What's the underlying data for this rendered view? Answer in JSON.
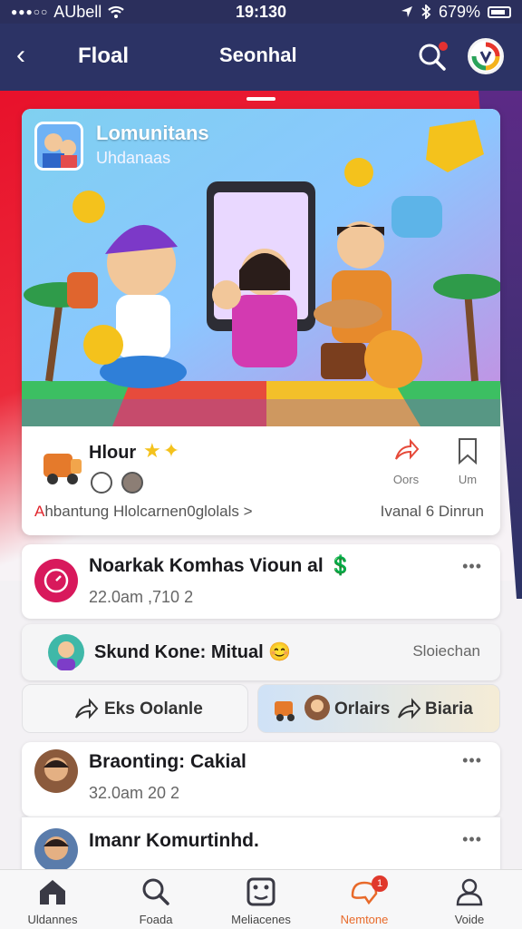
{
  "status_bar": {
    "carrier": "AUbell",
    "time": "19:130",
    "battery": "679%",
    "dots": "●●●○○"
  },
  "header": {
    "back_glyph": "‹",
    "title": "Floal",
    "center_title": "Seonhal"
  },
  "hero": {
    "title": "Lomunitans",
    "subtitle": "Uhdanaas",
    "host_name": "Hlour",
    "stars": "★✦",
    "share_label": "Oors",
    "save_label": "Um",
    "link_first": "A",
    "link_text": "hbantung Hlolcarnen0glolals",
    "link_chevron": ">",
    "right_text": "Ivanal 6 Dinrun"
  },
  "cards": [
    {
      "title": "Noarkak Komhas Vioun al",
      "title_emoji": "💲",
      "subtitle": "22.0am ,710  2",
      "more": "•••"
    },
    {
      "title": "Skund Kone: Mitual",
      "title_emoji": "😊",
      "right": "Sloiechan"
    },
    {
      "title": "Braonting: Cakial",
      "subtitle": "32.0am 20  2",
      "more": "•••"
    },
    {
      "title": "Imanr Komurtinhd.",
      "subtitle": "",
      "more": "•••"
    }
  ],
  "pills": {
    "left_label": "Eks  Oolanle",
    "right_label1": "Orlairs",
    "right_label2": "Biaria"
  },
  "bottom_nav": [
    {
      "label": "Uldannes",
      "icon": "home-icon"
    },
    {
      "label": "Foada",
      "icon": "search-icon"
    },
    {
      "label": "Meliacenes",
      "icon": "dice-icon"
    },
    {
      "label": "Nemtone",
      "icon": "heart-chat-icon",
      "badge": "1",
      "active": true
    },
    {
      "label": "Voide",
      "icon": "profile-icon"
    }
  ],
  "colors": {
    "header": "#2c3365",
    "accent_red": "#e8112b",
    "active_nav": "#e86a2a"
  }
}
